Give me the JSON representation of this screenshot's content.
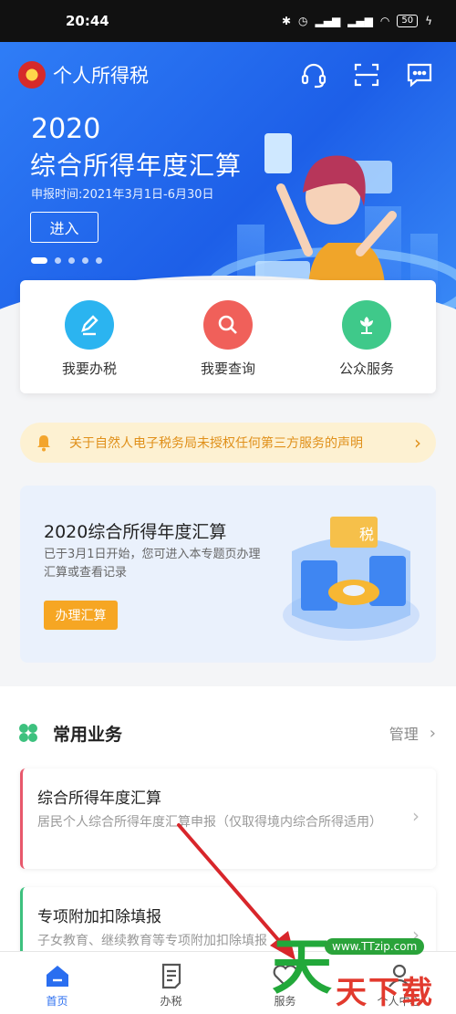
{
  "status_bar": {
    "time": "20:44",
    "battery": "50"
  },
  "header": {
    "title": "个人所得税",
    "icons": [
      "headset-icon",
      "scan-icon",
      "message-icon"
    ]
  },
  "banner": {
    "year": "2020",
    "title": "综合所得年度汇算",
    "period": "申报时间:2021年3月1日-6月30日",
    "enter_label": "进入",
    "slide_count": 5,
    "active_slide": 1
  },
  "quick_actions": [
    {
      "label": "我要办税",
      "icon": "pen-icon",
      "color": "#2bb4f0"
    },
    {
      "label": "我要查询",
      "icon": "search-icon",
      "color": "#f0605a"
    },
    {
      "label": "公众服务",
      "icon": "flower-icon",
      "color": "#3fc98a"
    }
  ],
  "notice": {
    "text": "关于自然人电子税务局未授权任何第三方服务的声明",
    "icon": "bell-icon"
  },
  "promo": {
    "title": "2020综合所得年度汇算",
    "desc": "已于3月1日开始，您可进入本专题页办理汇算或查看记录",
    "button": "办理汇算",
    "badge": "税"
  },
  "section": {
    "title": "常用业务",
    "manage": "管理"
  },
  "business": [
    {
      "title": "综合所得年度汇算",
      "desc": "居民个人综合所得年度汇算申报（仅取得境内综合所得适用）",
      "accent": "#e8586c"
    },
    {
      "title": "专项附加扣除填报",
      "desc": "子女教育、继续教育等专项附加扣除填报",
      "accent": "#3dc17e"
    }
  ],
  "tabs": [
    {
      "label": "首页",
      "icon": "home-icon",
      "active": true
    },
    {
      "label": "办税",
      "icon": "document-icon",
      "active": false
    },
    {
      "label": "服务",
      "icon": "heart-icon",
      "active": false
    },
    {
      "label": "个人中心",
      "icon": "user-icon",
      "active": false
    }
  ],
  "watermark": {
    "url": "www.TTzip.com",
    "big": "天",
    "small": "天下载"
  },
  "colors": {
    "primary": "#2a6ef0",
    "accent_orange": "#f6a623",
    "notice_bg": "#fdf1d2"
  }
}
